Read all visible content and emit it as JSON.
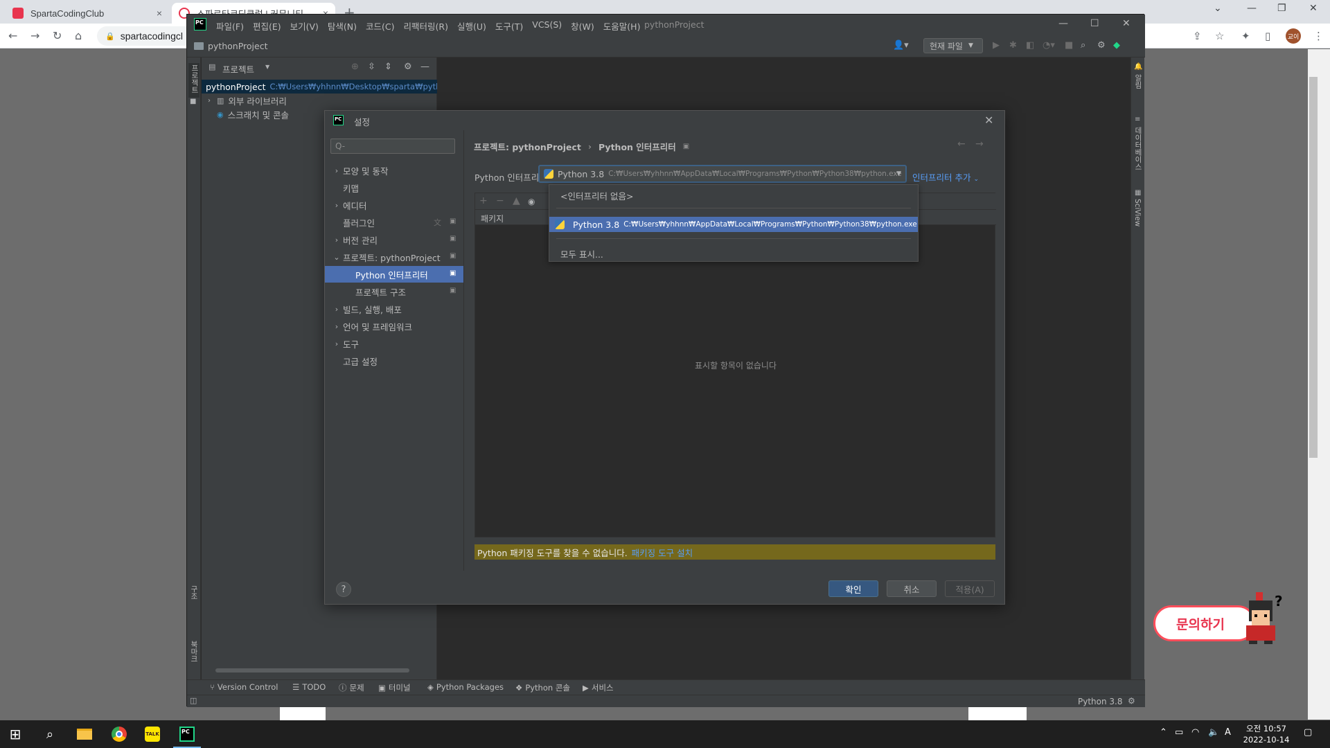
{
  "browser": {
    "tabs": [
      {
        "title": "SpartaCodingClub",
        "favicon_color": "#e8344e"
      },
      {
        "title": "스파르타코딩클럽 | 커뮤니티",
        "favicon_color": "#e8344e"
      }
    ],
    "close_glyph": "×",
    "new_tab_glyph": "+",
    "url": "spartacodingcl",
    "profile_initials": "교이"
  },
  "page": {
    "inquiry_button": "문의하기"
  },
  "taskbar": {
    "start": "⊞",
    "search": "⌕",
    "time": "오전 10:57",
    "date": "2022-10-14",
    "ime": "A"
  },
  "ide": {
    "logo": "PC",
    "menu": [
      "파일(F)",
      "편집(E)",
      "보기(V)",
      "탐색(N)",
      "코드(C)",
      "리팩터링(R)",
      "실행(U)",
      "도구(T)",
      "VCS(S)",
      "창(W)",
      "도움말(H)"
    ],
    "window_title": "pythonProject",
    "nav_project": "pythonProject",
    "run_config": "현재 파일",
    "left_stripe": {
      "project": "프로젝트",
      "structure": "구조",
      "bookmarks": "북마크"
    },
    "right_stripe": {
      "notifications": "알림",
      "db": "데이터베이스",
      "sciview": "SciView"
    },
    "project_panel": {
      "title": "프로젝트",
      "tree": [
        {
          "name": "pythonProject",
          "path": "C:₩Users₩yhhnn₩Desktop₩sparta₩pyth"
        },
        {
          "name": "외부 라이브러리",
          "path": ""
        },
        {
          "name": "스크래치 및 콘솔",
          "path": ""
        }
      ]
    },
    "bottom_tabs": [
      "Version Control",
      "TODO",
      "문제",
      "터미널",
      "Python Packages",
      "Python 콘솔",
      "서비스"
    ],
    "status_interpreter": "Python 3.8"
  },
  "dialog": {
    "title": "설정",
    "search_placeholder": "Q-",
    "sidebar": [
      {
        "label": "모양 및 동작",
        "expandable": true,
        "expanded": false
      },
      {
        "label": "키맵",
        "expandable": false
      },
      {
        "label": "에디터",
        "expandable": true,
        "expanded": false
      },
      {
        "label": "플러그인",
        "expandable": false
      },
      {
        "label": "버전 관리",
        "expandable": true,
        "expanded": false
      },
      {
        "label": "프로젝트: pythonProject",
        "expandable": true,
        "expanded": true
      },
      {
        "label": "Python 인터프리터",
        "expandable": false,
        "selected": true
      },
      {
        "label": "프로젝트 구조",
        "expandable": false
      },
      {
        "label": "빌드, 실행, 배포",
        "expandable": true,
        "expanded": false
      },
      {
        "label": "언어 및 프레임워크",
        "expandable": true,
        "expanded": false
      },
      {
        "label": "도구",
        "expandable": true,
        "expanded": false
      },
      {
        "label": "고급 설정",
        "expandable": false
      }
    ],
    "breadcrumb": [
      "프로젝트: pythonProject",
      "Python 인터프리터"
    ],
    "interpreter_label": "Python 인터프리터:",
    "interpreter": {
      "name": "Python 3.8",
      "path": "C:₩Users₩yhhnn₩AppData₩Local₩Programs₩Python₩Python38₩python.exe"
    },
    "add_interpreter": "인터프리터 추가",
    "dropdown": {
      "no_interpreter": "<인터프리터 없음>",
      "option_name": "Python 3.8",
      "option_path": "C:₩Users₩yhhnn₩AppData₩Local₩Programs₩Python₩Python38₩python.exe",
      "show_all": "모두 표시..."
    },
    "table_header": "패키지",
    "empty_text": "표시할 항목이 없습니다",
    "warning_text": "Python 패키징 도구를 찾을 수 없습니다.",
    "warning_link": "패키징 도구 설치",
    "buttons": {
      "ok": "확인",
      "cancel": "취소",
      "apply": "적용(A)",
      "help": "?"
    },
    "colors": {
      "selection": "#4b6eaf",
      "warning": "#75681c",
      "link": "#589df6",
      "primary_button": "#365880"
    }
  }
}
